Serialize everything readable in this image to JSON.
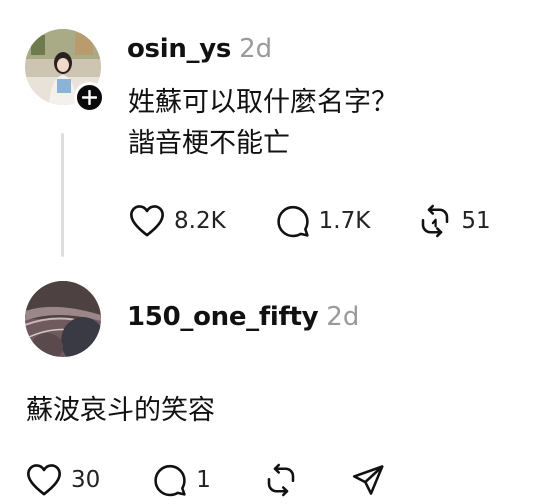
{
  "post1": {
    "username": "osin_ys",
    "time": "2d",
    "lines": [
      "姓蘇可以取什麼名字？",
      "諧音梗不能亡"
    ],
    "likes": "8.2K",
    "replies": "1.7K",
    "reposts": "51"
  },
  "post2": {
    "username": "150_one_fifty",
    "time": "2d",
    "text": "蘇波哀斗的笑容",
    "likes": "30",
    "replies": "1"
  },
  "icons": {
    "like": "heart-icon",
    "reply": "comment-icon",
    "repost": "repost-icon",
    "share": "share-icon",
    "follow": "plus-icon"
  },
  "colors": {
    "text": "#101010",
    "muted": "#9a9a9a",
    "thread_line": "#dedede"
  }
}
